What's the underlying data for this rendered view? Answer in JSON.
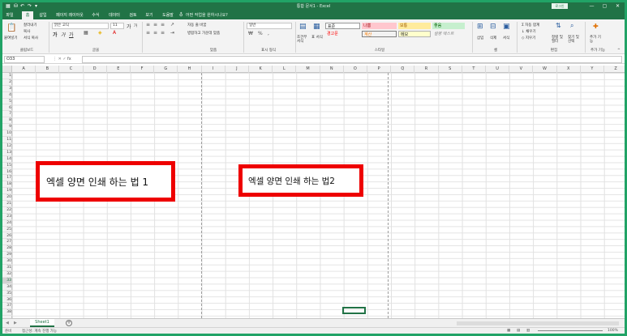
{
  "window": {
    "title": "통합 문서1 - Excel",
    "login_label": "로그인",
    "controls": [
      "—",
      "▢",
      "✕"
    ]
  },
  "quick_access": [
    "⛁",
    "↶",
    "↷",
    "▾"
  ],
  "tabs": [
    "파일",
    "홈",
    "삽입",
    "페이지 레이아웃",
    "수식",
    "데이터",
    "검토",
    "보기",
    "도움말"
  ],
  "tell_me": "어떤 작업을 원하시나요?",
  "ribbon": {
    "clipboard": {
      "paste": "붙여넣기",
      "cut": "잘라내기",
      "copy": "복사",
      "format_painter": "서식 복사",
      "label": "클립보드"
    },
    "font": {
      "name": "맑은 고딕",
      "size": "11",
      "grow": "가",
      "shrink": "가",
      "bold": "가",
      "italic": "가",
      "underline": "가",
      "label": "글꼴"
    },
    "alignment": {
      "wrap": "자동 줄 바꿈",
      "merge": "병합하고 가운데 맞춤",
      "label": "맞춤"
    },
    "number": {
      "format": "일반",
      "label": "표시 형식"
    },
    "styles": {
      "conditional": "조건부 서식",
      "table": "표 서식",
      "normal": "표준",
      "bad": "나쁨",
      "good": "보통",
      "neutral": "좋음",
      "warning": "경고문",
      "calculation": "계산",
      "note": "메모",
      "explanatory": "설명 텍스트",
      "label": "스타일"
    },
    "cells": {
      "insert": "삽입",
      "delete": "삭제",
      "format": "서식",
      "label": "셀"
    },
    "editing": {
      "autosum": "자동 합계",
      "fill": "채우기",
      "clear": "지우기",
      "sort": "정렬 및 필터",
      "find": "찾기 및 선택",
      "label": "편집"
    },
    "addins": {
      "addin": "추가 기능",
      "label": "추가 기능"
    }
  },
  "name_box": "O33",
  "fx": "fx",
  "columns": [
    "A",
    "B",
    "C",
    "D",
    "E",
    "F",
    "G",
    "H",
    "I",
    "J",
    "K",
    "L",
    "M",
    "N",
    "O",
    "P",
    "Q",
    "R",
    "S",
    "T",
    "U",
    "V",
    "W",
    "X",
    "Y",
    "Z"
  ],
  "rows": [
    "1",
    "2",
    "3",
    "4",
    "5",
    "6",
    "7",
    "8",
    "9",
    "10",
    "11",
    "12",
    "13",
    "14",
    "15",
    "16",
    "17",
    "18",
    "19",
    "20",
    "21",
    "22",
    "23",
    "24",
    "25",
    "26",
    "27",
    "28",
    "29",
    "30",
    "31",
    "32",
    "33",
    "34",
    "35",
    "36",
    "37",
    "38"
  ],
  "selected_row": "33",
  "text_boxes": [
    {
      "text": "엑셀 양면 인쇄 하는 법 1"
    },
    {
      "text": "엑셀 양면 인쇄 하는 법2"
    }
  ],
  "sheet": {
    "tab": "Sheet1",
    "add": "+"
  },
  "status": {
    "ready": "준비",
    "accessibility": "접근성: 계속 진행 가능",
    "zoom": "100%"
  },
  "colors": {
    "brand": "#217346",
    "callout_border": "#ee0000"
  }
}
